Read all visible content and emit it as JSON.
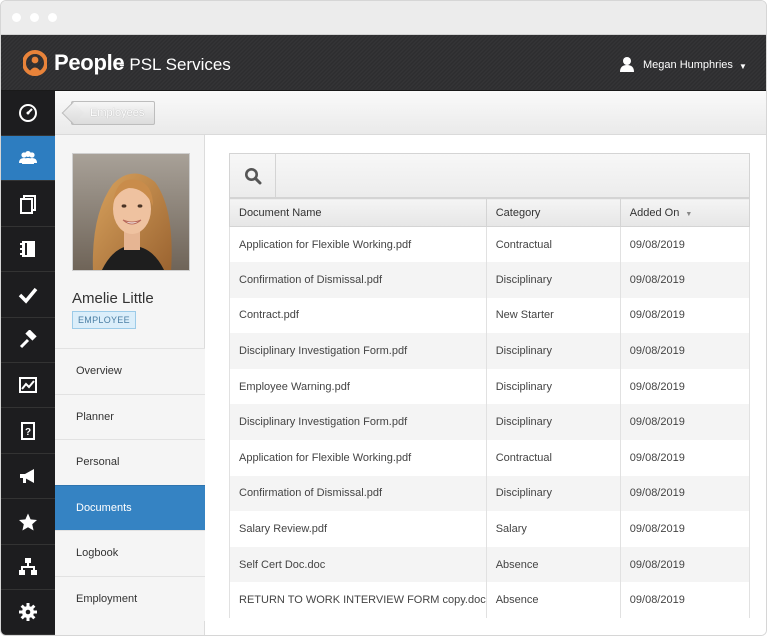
{
  "header": {
    "app_name": "People",
    "app_subtitle": "- PSL Services",
    "user_name": "Megan Humphries",
    "accent_color": "#e8833a"
  },
  "sidebar_icons": [
    {
      "icon": "dashboard-icon",
      "active": false
    },
    {
      "icon": "people-icon",
      "active": true
    },
    {
      "icon": "documents-icon",
      "active": false
    },
    {
      "icon": "notebook-icon",
      "active": false
    },
    {
      "icon": "checkmark-icon",
      "active": false
    },
    {
      "icon": "hammer-icon",
      "active": false
    },
    {
      "icon": "chart-icon",
      "active": false
    },
    {
      "icon": "help-document-icon",
      "active": false
    },
    {
      "icon": "megaphone-icon",
      "active": false
    },
    {
      "icon": "star-icon",
      "active": false
    },
    {
      "icon": "org-chart-icon",
      "active": false
    },
    {
      "icon": "gear-icon",
      "active": false
    }
  ],
  "breadcrumb": {
    "label": "Employees"
  },
  "employee": {
    "name": "Amelie Little",
    "badge": "EMPLOYEE"
  },
  "nav": {
    "items": [
      {
        "label": "Overview"
      },
      {
        "label": "Planner"
      },
      {
        "label": "Personal"
      },
      {
        "label": "Documents"
      },
      {
        "label": "Logbook"
      },
      {
        "label": "Employment"
      }
    ],
    "active_index": 3
  },
  "search": {
    "value": "",
    "placeholder": ""
  },
  "table": {
    "headers": {
      "name": "Document Name",
      "category": "Category",
      "added": "Added On"
    },
    "rows": [
      {
        "name": "Application for Flexible Working.pdf",
        "category": "Contractual",
        "added": "09/08/2019"
      },
      {
        "name": "Confirmation of Dismissal.pdf",
        "category": "Disciplinary",
        "added": "09/08/2019"
      },
      {
        "name": "Contract.pdf",
        "category": "New Starter",
        "added": "09/08/2019"
      },
      {
        "name": "Disciplinary Investigation Form.pdf",
        "category": "Disciplinary",
        "added": "09/08/2019"
      },
      {
        "name": "Employee Warning.pdf",
        "category": "Disciplinary",
        "added": "09/08/2019"
      },
      {
        "name": "Disciplinary Investigation Form.pdf",
        "category": "Disciplinary",
        "added": "09/08/2019"
      },
      {
        "name": "Application for Flexible Working.pdf",
        "category": "Contractual",
        "added": "09/08/2019"
      },
      {
        "name": "Confirmation of Dismissal.pdf",
        "category": "Disciplinary",
        "added": "09/08/2019"
      },
      {
        "name": "Salary Review.pdf",
        "category": "Salary",
        "added": "09/08/2019"
      },
      {
        "name": "Self Cert Doc.doc",
        "category": "Absence",
        "added": "09/08/2019"
      },
      {
        "name": "RETURN TO WORK INTERVIEW FORM copy.doc",
        "category": "Absence",
        "added": "09/08/2019"
      }
    ]
  }
}
